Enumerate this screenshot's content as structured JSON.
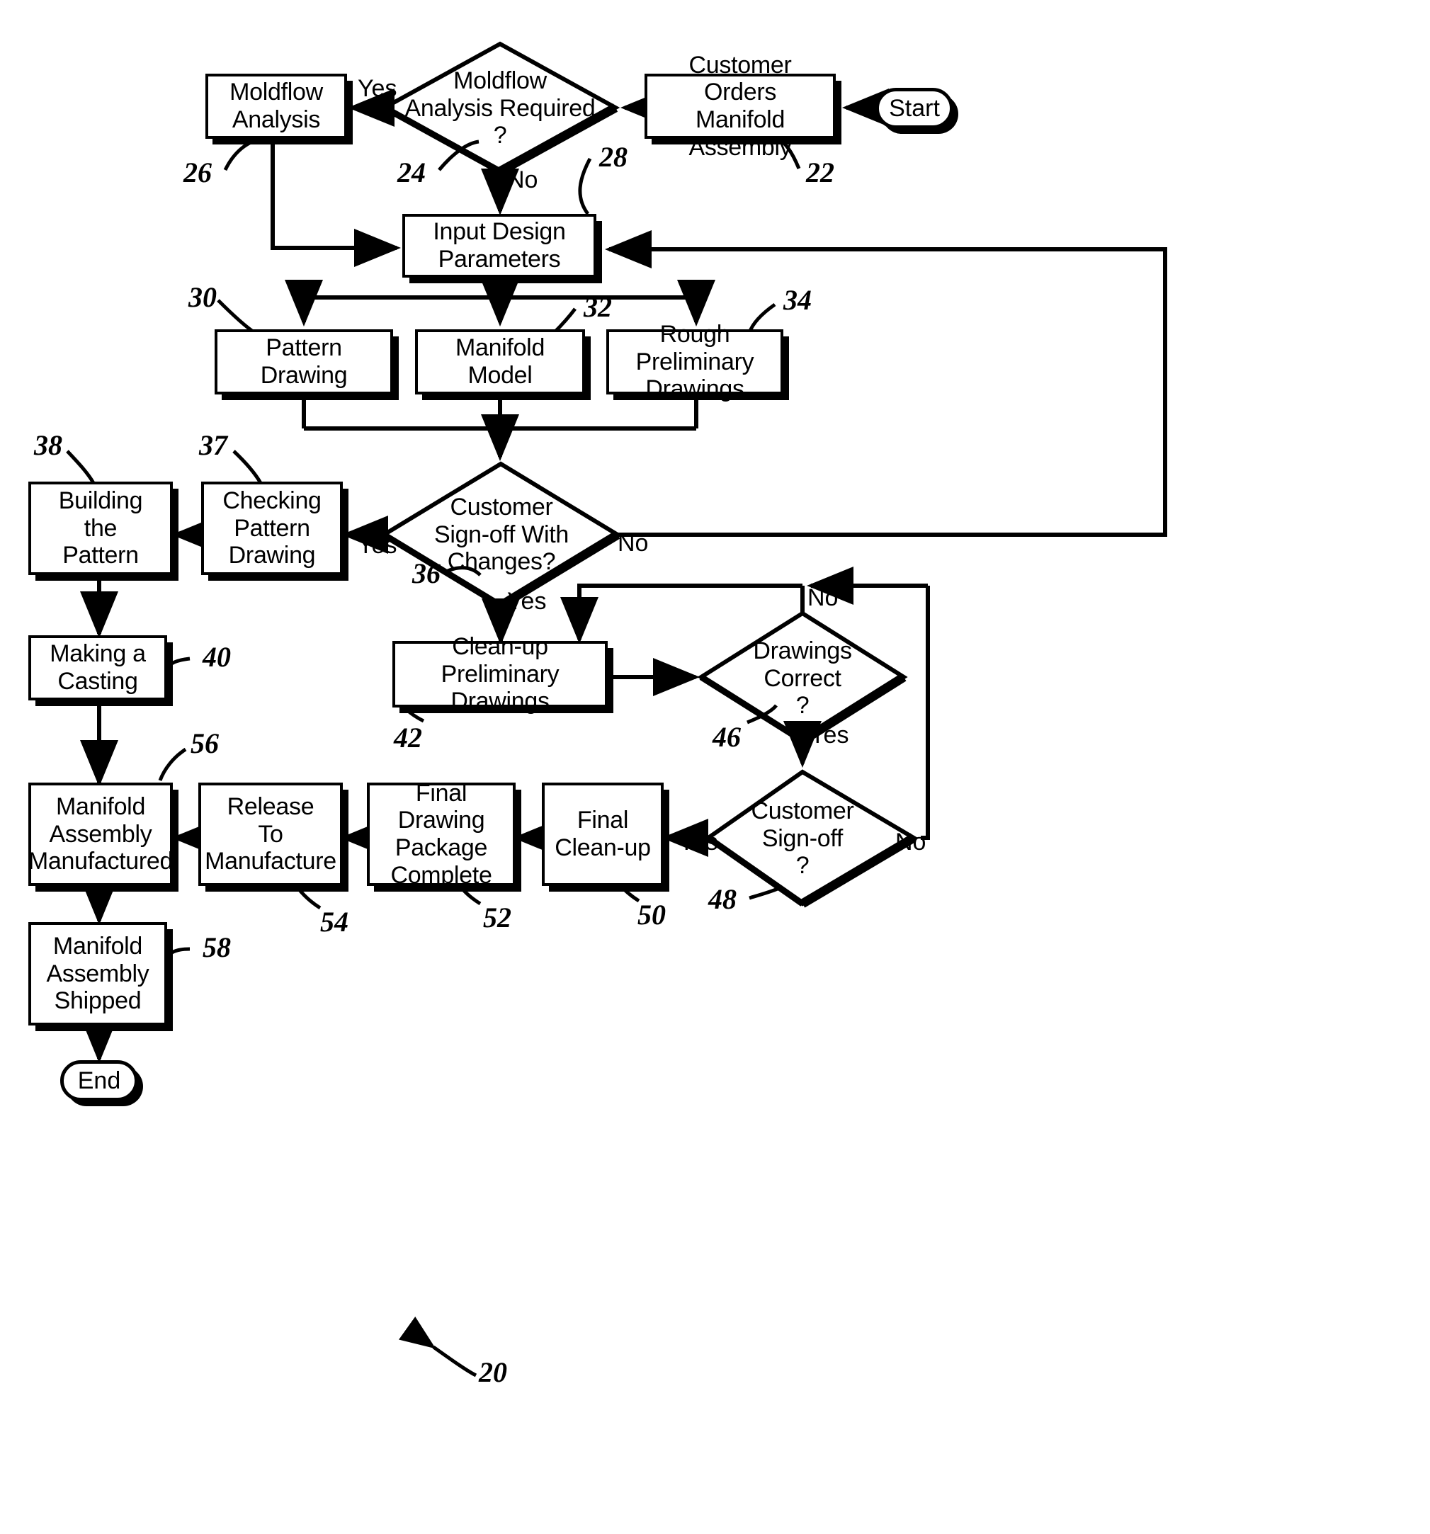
{
  "figure": {
    "kind": "patent-flowchart",
    "overall_ref": "20",
    "start_label": "Start",
    "end_label": "End"
  },
  "nodes": {
    "moldflow_analysis": {
      "label": "Moldflow\nAnalysis",
      "ref": "26",
      "shape": "process"
    },
    "moldflow_required": {
      "label": "Moldflow\nAnalysis Required\n?",
      "ref": "24",
      "shape": "decision"
    },
    "customer_orders": {
      "label": "Customer Orders\nManifold Assembly",
      "ref": "22",
      "shape": "process"
    },
    "start": {
      "label": "Start",
      "shape": "terminator"
    },
    "input_design": {
      "label": "Input Design\nParameters",
      "ref": "28",
      "shape": "process"
    },
    "pattern_drawing": {
      "label": "Pattern\nDrawing",
      "ref": "30",
      "shape": "process"
    },
    "manifold_model": {
      "label": "Manifold\nModel",
      "ref": "32",
      "shape": "process"
    },
    "rough_prelim": {
      "label": "Rough Preliminary\nDrawings",
      "ref": "34",
      "shape": "process"
    },
    "customer_signoff_changes": {
      "label": "Customer\nSign-off With\nChanges?",
      "ref": "36",
      "shape": "decision"
    },
    "checking_pattern": {
      "label": "Checking\nPattern\nDrawing",
      "ref": "37",
      "shape": "process"
    },
    "building_pattern": {
      "label": "Building\nthe\nPattern",
      "ref": "38",
      "shape": "process"
    },
    "making_casting": {
      "label": "Making a\nCasting",
      "ref": "40",
      "shape": "process"
    },
    "cleanup_prelim": {
      "label": "Clean-up\nPreliminary Drawings",
      "ref": "42",
      "shape": "process"
    },
    "drawings_correct": {
      "label": "Drawings\nCorrect\n?",
      "ref": "46",
      "shape": "decision"
    },
    "customer_signoff": {
      "label": "Customer\nSign-off\n?",
      "ref": "48",
      "shape": "decision"
    },
    "final_cleanup": {
      "label": "Final\nClean-up",
      "ref": "50",
      "shape": "process"
    },
    "final_drawing_pkg": {
      "label": "Final Drawing\nPackage\nComplete",
      "ref": "52",
      "shape": "process"
    },
    "release_manufacture": {
      "label": "Release\nTo\nManufacture",
      "ref": "54",
      "shape": "process"
    },
    "manifold_manufactured": {
      "label": "Manifold\nAssembly\nManufactured",
      "ref": "56",
      "shape": "process"
    },
    "manifold_shipped": {
      "label": "Manifold\nAssembly\nShipped",
      "ref": "58",
      "shape": "process"
    },
    "end": {
      "label": "End",
      "shape": "terminator"
    }
  },
  "edge_labels": {
    "moldflow_yes": "Yes",
    "moldflow_no": "No",
    "signoff_changes_yes_left": "Yes",
    "signoff_changes_no": "No",
    "signoff_changes_yes_down": "Yes",
    "drawings_correct_no": "No",
    "drawings_correct_yes": "Yes",
    "customer_signoff_yes": "Yes",
    "customer_signoff_no": "No"
  },
  "refs": {
    "r20": "20",
    "r22": "22",
    "r24": "24",
    "r26": "26",
    "r28": "28",
    "r30": "30",
    "r32": "32",
    "r34": "34",
    "r36": "36",
    "r37": "37",
    "r38": "38",
    "r40": "40",
    "r42": "42",
    "r46": "46",
    "r48": "48",
    "r50": "50",
    "r52": "52",
    "r54": "54",
    "r56": "56",
    "r58": "58"
  },
  "colors": {
    "ink": "#000000",
    "paper": "#ffffff"
  }
}
